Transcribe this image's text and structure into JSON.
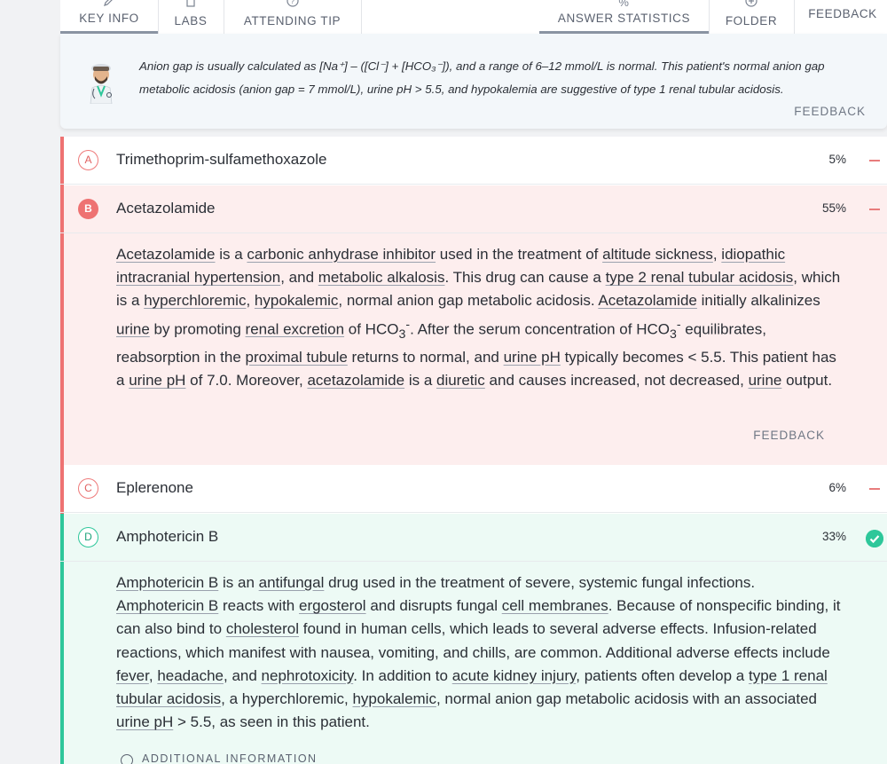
{
  "toolbar": {
    "tabs": [
      "KEY INFO",
      "LABS",
      "ATTENDING TIP",
      "ANSWER STATISTICS",
      "FOLDER",
      "FEEDBACK"
    ],
    "percent_symbol": "%"
  },
  "tip": {
    "line1": "Anion gap is usually calculated as [Na⁺] – ([Cl⁻] + [HCO₃⁻]), and a range of 6–12 mmol/L is normal. This patient's normal anion gap",
    "line2": "metabolic acidosis (anion gap = 7 mmol/L), urine pH > 5.5, and hypokalemia are suggestive of type 1 renal tubular acidosis.",
    "feedback": "FEEDBACK"
  },
  "answers": [
    {
      "letter": "A",
      "text": "Trimethoprim-sulfamethoxazole",
      "percent": "5%",
      "status": "incorrect"
    },
    {
      "letter": "B",
      "text": "Acetazolamide",
      "percent": "55%",
      "status": "selected-incorrect"
    },
    {
      "letter": "C",
      "text": "Eplerenone",
      "percent": "6%",
      "status": "incorrect"
    },
    {
      "letter": "D",
      "text": "Amphotericin B",
      "percent": "33%",
      "status": "correct"
    }
  ],
  "explanation_b": {
    "feedback": "FEEDBACK"
  },
  "additional_info": "ADDITIONAL INFORMATION",
  "colors": {
    "incorrect": "#ee7272",
    "correct": "#2ec79a",
    "incorrect_bg": "#fdeeee",
    "correct_bg": "#edfaf5"
  }
}
